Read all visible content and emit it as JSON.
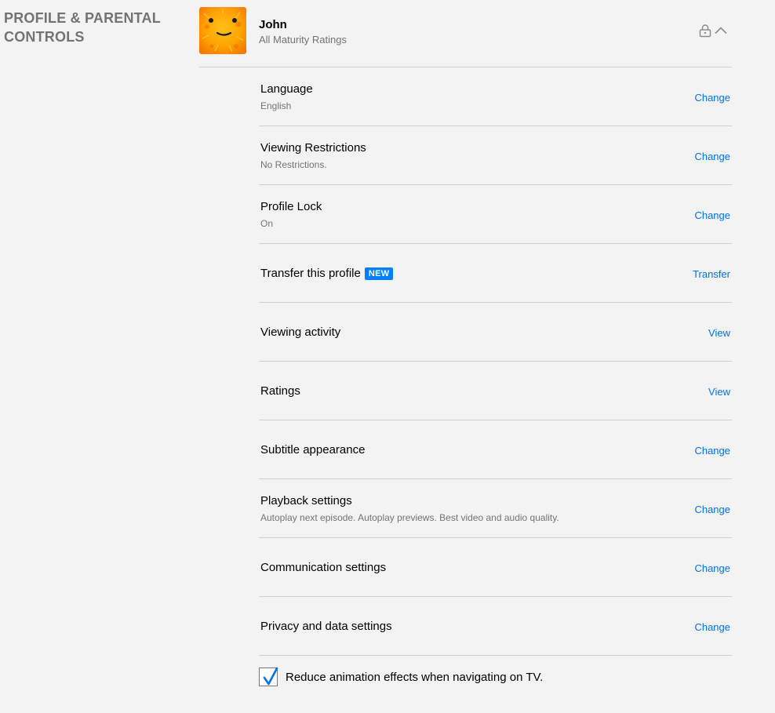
{
  "section": {
    "title": "PROFILE & PARENTAL CONTROLS"
  },
  "profile": {
    "name": "John",
    "subtitle": "All Maturity Ratings",
    "avatar_icon": "sun-face-avatar",
    "locked": true,
    "expanded": true
  },
  "rows": [
    {
      "title": "Language",
      "subtitle": "English",
      "action": "Change"
    },
    {
      "title": "Viewing Restrictions",
      "subtitle": "No Restrictions.",
      "action": "Change"
    },
    {
      "title": "Profile Lock",
      "subtitle": "On",
      "action": "Change"
    },
    {
      "title": "Transfer this profile",
      "badge": "NEW",
      "action": "Transfer"
    },
    {
      "title": "Viewing activity",
      "action": "View"
    },
    {
      "title": "Ratings",
      "action": "View"
    },
    {
      "title": "Subtitle appearance",
      "action": "Change"
    },
    {
      "title": "Playback settings",
      "subtitle": "Autoplay next episode. Autoplay previews. Best video and audio quality.",
      "action": "Change"
    },
    {
      "title": "Communication settings",
      "action": "Change"
    },
    {
      "title": "Privacy and data settings",
      "action": "Change"
    }
  ],
  "reduce_animation": {
    "label": "Reduce animation effects when navigating on TV.",
    "checked": true
  },
  "colors": {
    "link": "#0071eb",
    "badge": "#0080ff",
    "section_title": "#737373",
    "divider": "#d1d1d1",
    "background": "#f3f3f3"
  }
}
